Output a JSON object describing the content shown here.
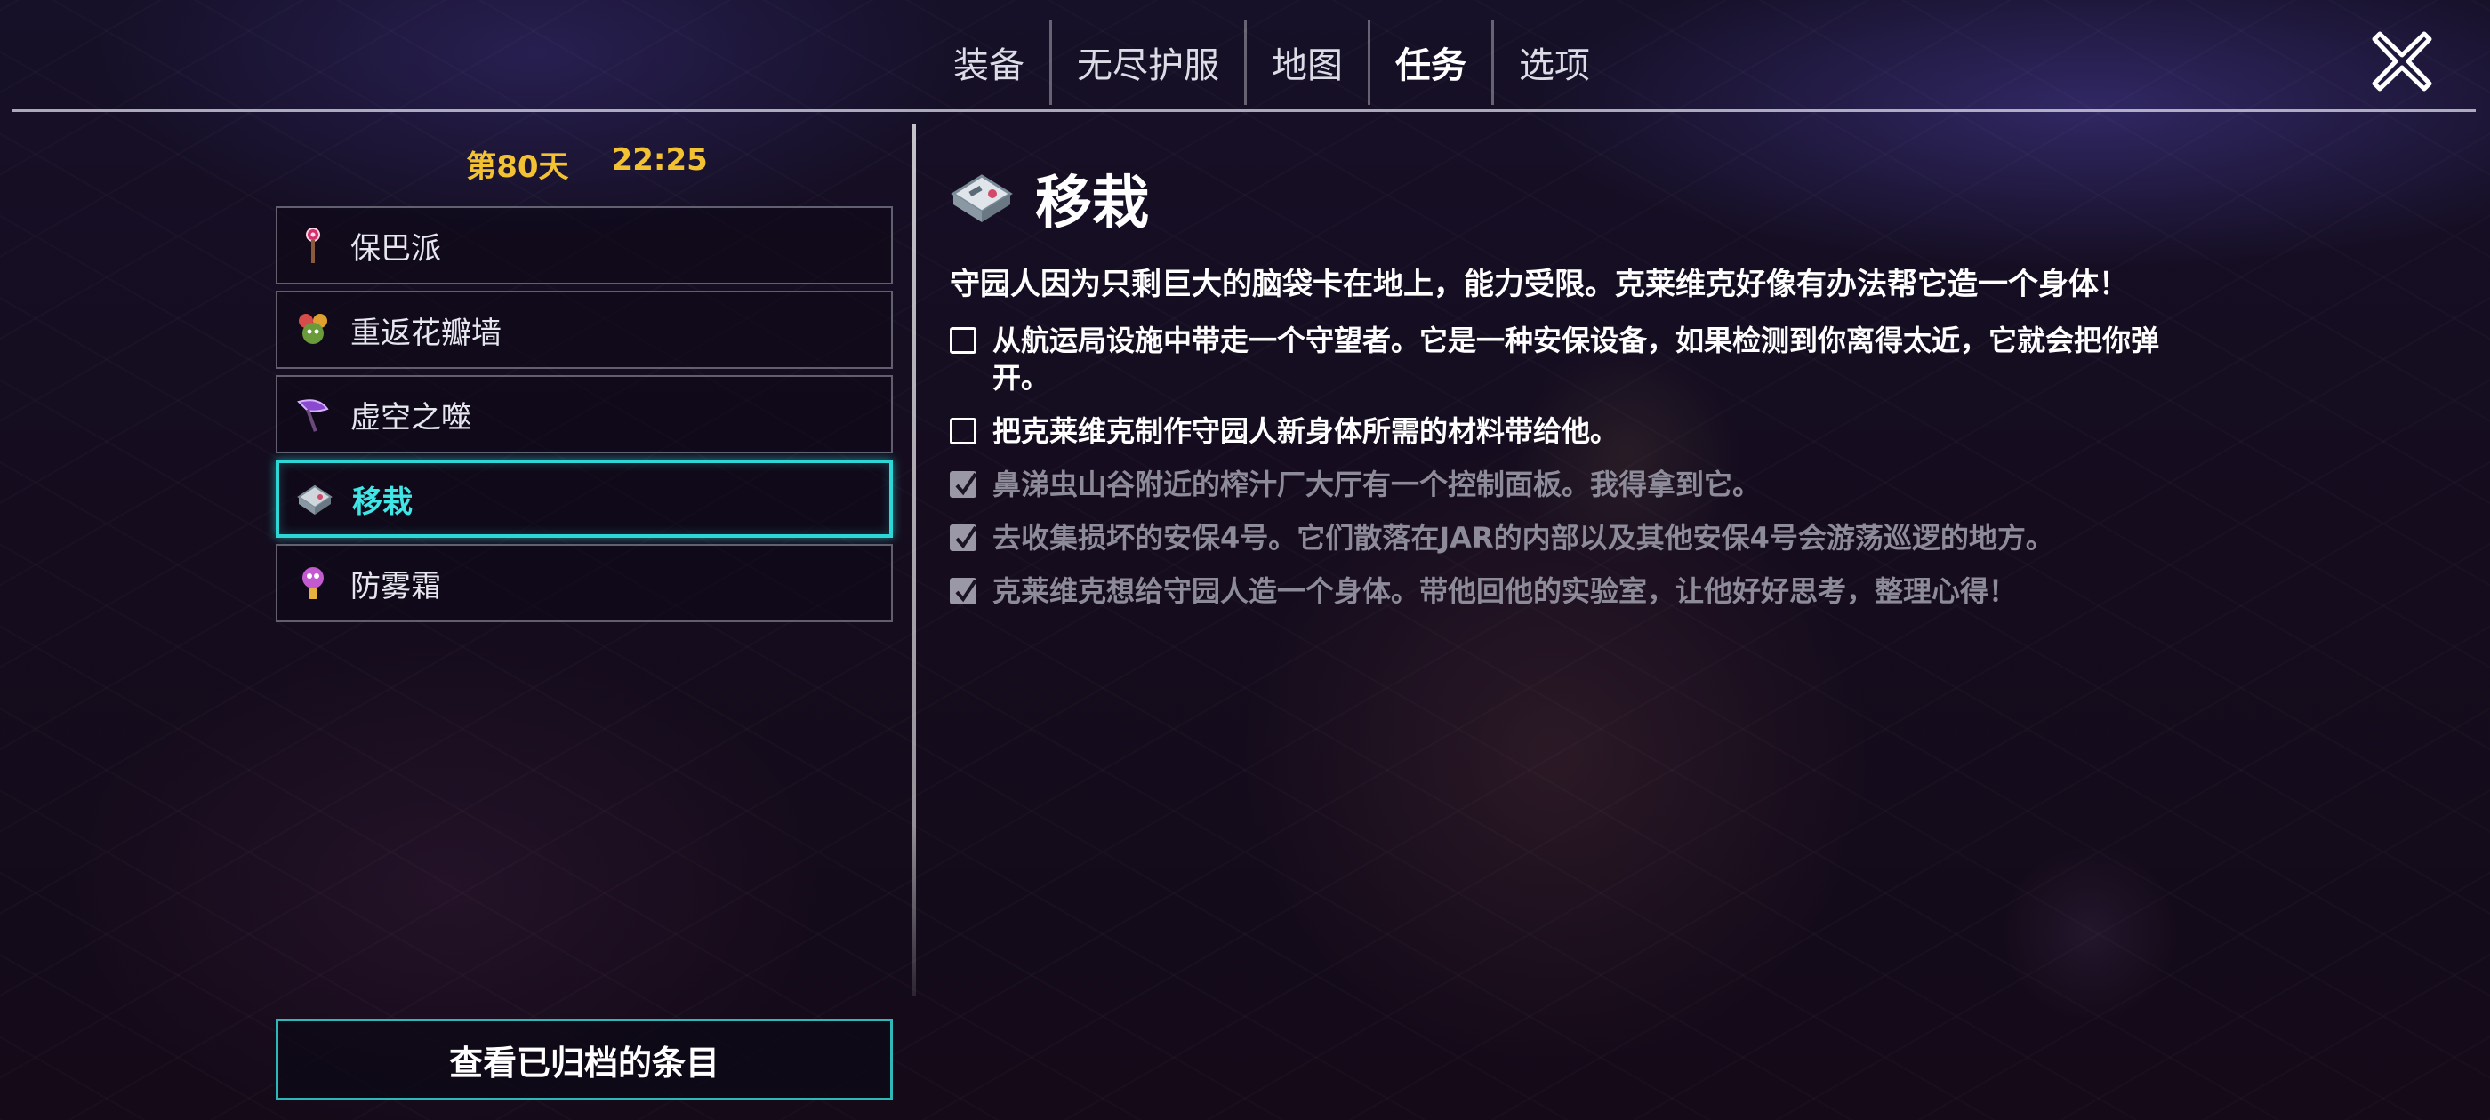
{
  "tabs": [
    {
      "label": "装备"
    },
    {
      "label": "无尽护服"
    },
    {
      "label": "地图"
    },
    {
      "label": "任务",
      "active": true
    },
    {
      "label": "选项"
    }
  ],
  "status": {
    "day": "第80天",
    "time": "22:25"
  },
  "quests": [
    {
      "label": "保巴派",
      "icon": "staff-icon"
    },
    {
      "label": "重返花瓣墙",
      "icon": "flower-creature-icon"
    },
    {
      "label": "虚空之噬",
      "icon": "void-axe-icon"
    },
    {
      "label": "移栽",
      "icon": "device-icon",
      "selected": true
    },
    {
      "label": "防雾霜",
      "icon": "bulb-creature-icon"
    }
  ],
  "archive_button": "查看已归档的条目",
  "detail": {
    "title": "移栽",
    "icon": "device-icon",
    "description": "守园人因为只剩巨大的脑袋卡在地上，能力受限。克莱维克好像有办法帮它造一个身体！",
    "objectives": [
      {
        "text": "从航运局设施中带走一个守望者。它是一种安保设备，如果检测到你离得太近，它就会把你弹开。",
        "done": false
      },
      {
        "text": "把克莱维克制作守园人新身体所需的材料带给他。",
        "done": false
      },
      {
        "text": "鼻涕虫山谷附近的榨汁厂大厅有一个控制面板。我得拿到它。",
        "done": true
      },
      {
        "text": "去收集损坏的安保4号。它们散落在JAR的内部以及其他安保4号会游荡巡逻的地方。",
        "done": true
      },
      {
        "text": "克莱维克想给守园人造一个身体。带他回他的实验室，让他好好思考，整理心得！",
        "done": true
      }
    ]
  },
  "colors": {
    "accent": "#2fd6d6",
    "gold": "#f2c233",
    "done_text": "#8d8a99"
  }
}
